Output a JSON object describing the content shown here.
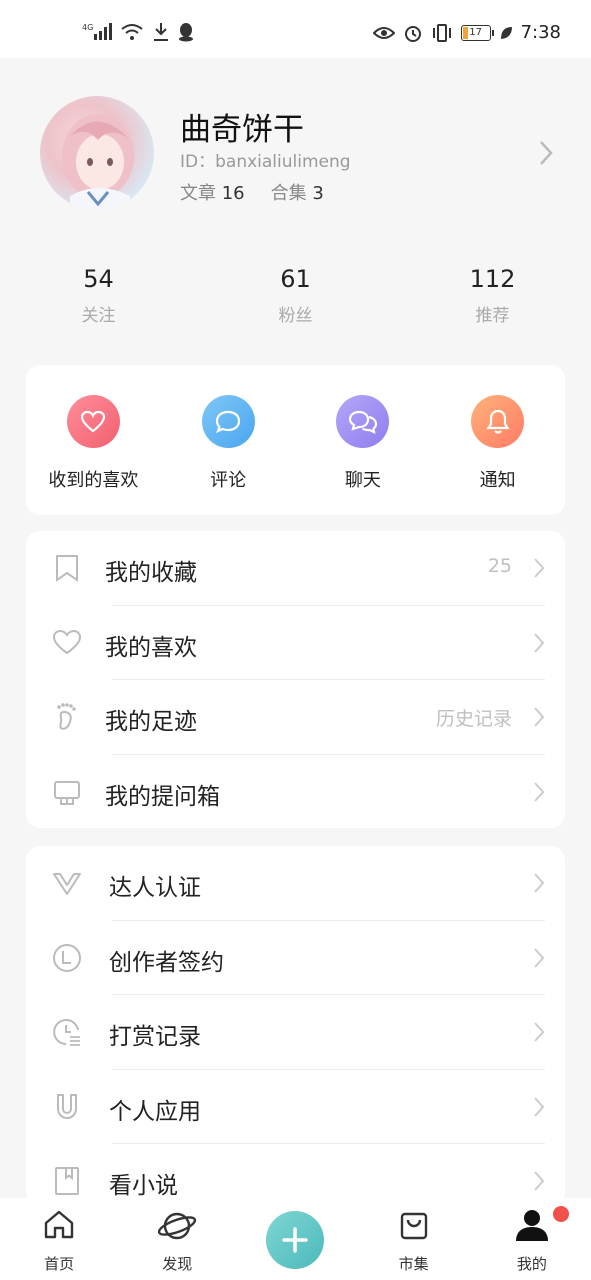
{
  "status_bar": {
    "network": "4G",
    "battery": "17",
    "time": "7:38"
  },
  "profile": {
    "name": "曲奇饼干",
    "id_label": "ID：",
    "id_value": "banxialiulimeng",
    "articles_label": "文章",
    "articles_count": "16",
    "collections_label": "合集",
    "collections_count": "3"
  },
  "stats": [
    {
      "value": "54",
      "label": "关注"
    },
    {
      "value": "61",
      "label": "粉丝"
    },
    {
      "value": "112",
      "label": "推荐"
    }
  ],
  "quick_actions": [
    {
      "label": "收到的喜欢",
      "icon": "heart-icon",
      "color_from": "#ff8e9b",
      "color_to": "#f2606f"
    },
    {
      "label": "评论",
      "icon": "comment-icon",
      "color_from": "#7fc7f7",
      "color_to": "#4aa6ef"
    },
    {
      "label": "聊天",
      "icon": "chat-icon",
      "color_from": "#b5a6f7",
      "color_to": "#8e7ef0"
    },
    {
      "label": "通知",
      "icon": "bell-icon",
      "color_from": "#ffb27a",
      "color_to": "#ff7b66"
    }
  ],
  "list1": [
    {
      "label": "我的收藏",
      "value": "25",
      "icon": "bookmark-icon"
    },
    {
      "label": "我的喜欢",
      "value": "",
      "icon": "heart-outline-icon"
    },
    {
      "label": "我的足迹",
      "value": "历史记录",
      "icon": "footprint-icon"
    },
    {
      "label": "我的提问箱",
      "value": "",
      "icon": "question-box-icon"
    }
  ],
  "list2": [
    {
      "label": "达人认证",
      "icon": "v-badge-icon"
    },
    {
      "label": "创作者签约",
      "icon": "contract-icon"
    },
    {
      "label": "打赏记录",
      "icon": "reward-record-icon"
    },
    {
      "label": "个人应用",
      "icon": "magnet-icon"
    },
    {
      "label": "看小说",
      "icon": "book-icon"
    }
  ],
  "tabbar": [
    {
      "label": "首页",
      "icon": "home-icon"
    },
    {
      "label": "发现",
      "icon": "planet-icon"
    },
    {
      "label": "",
      "icon": "add-icon"
    },
    {
      "label": "市集",
      "icon": "shopping-bag-icon"
    },
    {
      "label": "我的",
      "icon": "person-icon"
    }
  ],
  "colors": {
    "accent": "#4cb9bb",
    "badge": "#f2504b"
  }
}
